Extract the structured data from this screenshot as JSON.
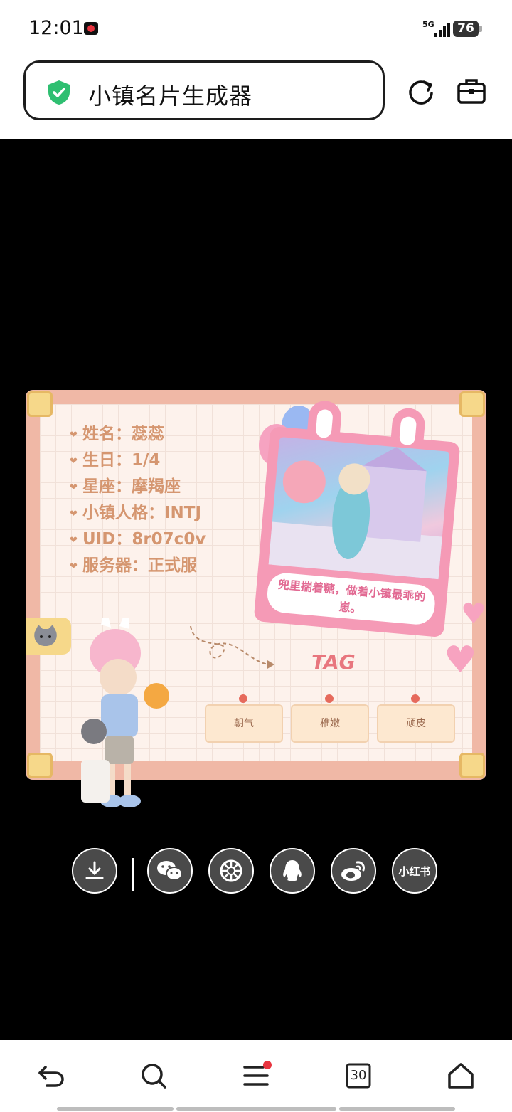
{
  "status_bar": {
    "time": "12:01",
    "network": "5G",
    "battery": "76",
    "icons": [
      "screen-record-icon",
      "signal-icon",
      "battery-icon"
    ]
  },
  "browser": {
    "page_title": "小镇名片生成器",
    "icons": [
      "security-shield-icon",
      "reload-icon",
      "toolbox-icon"
    ],
    "colors": {
      "shield": "#2fbf71"
    }
  },
  "card": {
    "info": [
      {
        "label": "姓名",
        "sep": "：",
        "value": "蕊蕊"
      },
      {
        "label": "生日",
        "sep": "：",
        "value": "1/4"
      },
      {
        "label": "星座",
        "sep": "：",
        "value": "摩羯座"
      },
      {
        "label": "小镇人格",
        "sep": "：",
        "value": "INTJ"
      },
      {
        "label": "UID",
        "sep": "：",
        "value": "8r07c0v"
      },
      {
        "label": "服务器",
        "sep": "：",
        "value": "正式服"
      }
    ],
    "photo_caption": "兜里揣着糖，做着小镇最乖的崽。",
    "tag_title": "TAG",
    "tags": [
      "朝气",
      "稚嫩",
      "顽皮"
    ],
    "colors": {
      "frame": "#f0b8a6",
      "paper": "#fdf2ec",
      "text": "#d59670",
      "photo": "#f59ab6"
    }
  },
  "share_actions": [
    {
      "name": "download-icon"
    },
    {
      "name": "wechat-icon"
    },
    {
      "name": "moments-icon"
    },
    {
      "name": "qq-icon"
    },
    {
      "name": "weibo-icon"
    },
    {
      "name": "xiaohongshu-icon",
      "label": "小红书"
    }
  ],
  "bottom_nav": {
    "tabs_count": "30",
    "icons": [
      "back-icon",
      "search-icon",
      "menu-icon",
      "tabs-icon",
      "home-icon"
    ],
    "colors": {
      "badge": "#e8343f"
    }
  }
}
